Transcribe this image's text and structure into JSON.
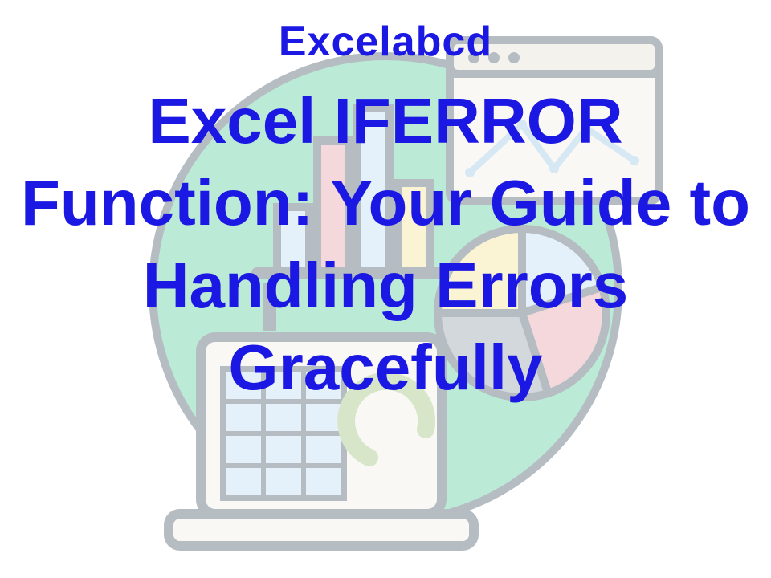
{
  "brand": "Excelabcd",
  "title": "Excel IFERROR Function: Your Guide to Handling Errors Gracefully",
  "colors": {
    "text": "#1b18e3",
    "background": "#ffffff"
  }
}
